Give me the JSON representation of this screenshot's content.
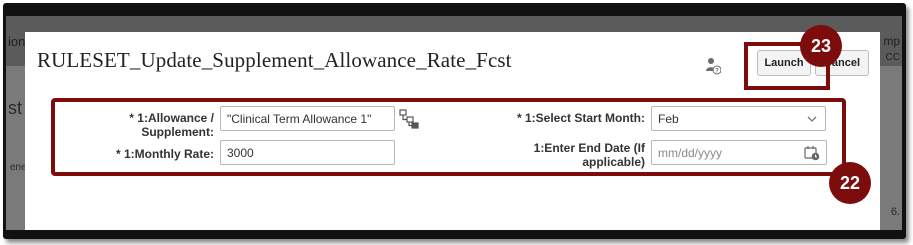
{
  "background": {
    "left_text_1": "ion",
    "left_text_2": "st",
    "left_text_3": "ene",
    "right_text_1": "mp",
    "right_text_2": "CC",
    "right_text_3": "6."
  },
  "dialog": {
    "title": "RULESET_Update_Supplement_Allowance_Rate_Fcst",
    "launch_label": "Launch",
    "cancel_label": "Cancel"
  },
  "form": {
    "allowance_label": "* 1:Allowance / Supplement:",
    "allowance_value": "\"Clinical Term Allowance 1\"",
    "monthly_rate_label": "* 1:Monthly Rate:",
    "monthly_rate_value": "3000",
    "start_month_label": "* 1:Select Start Month:",
    "start_month_value": "Feb",
    "end_date_label": "1:Enter End Date (If applicable)",
    "end_date_placeholder": "mm/dd/yyyy"
  },
  "callouts": {
    "step_launch": "23",
    "step_form": "22"
  },
  "colors": {
    "callout": "#7d0c0c",
    "dialog_bg": "#ffffff",
    "overlay_bg": "#6e6e6e"
  },
  "icons": {
    "help": "user-help-icon",
    "tree": "hierarchy-tree-icon",
    "chevron": "chevron-down-icon",
    "calendar": "calendar-icon"
  }
}
